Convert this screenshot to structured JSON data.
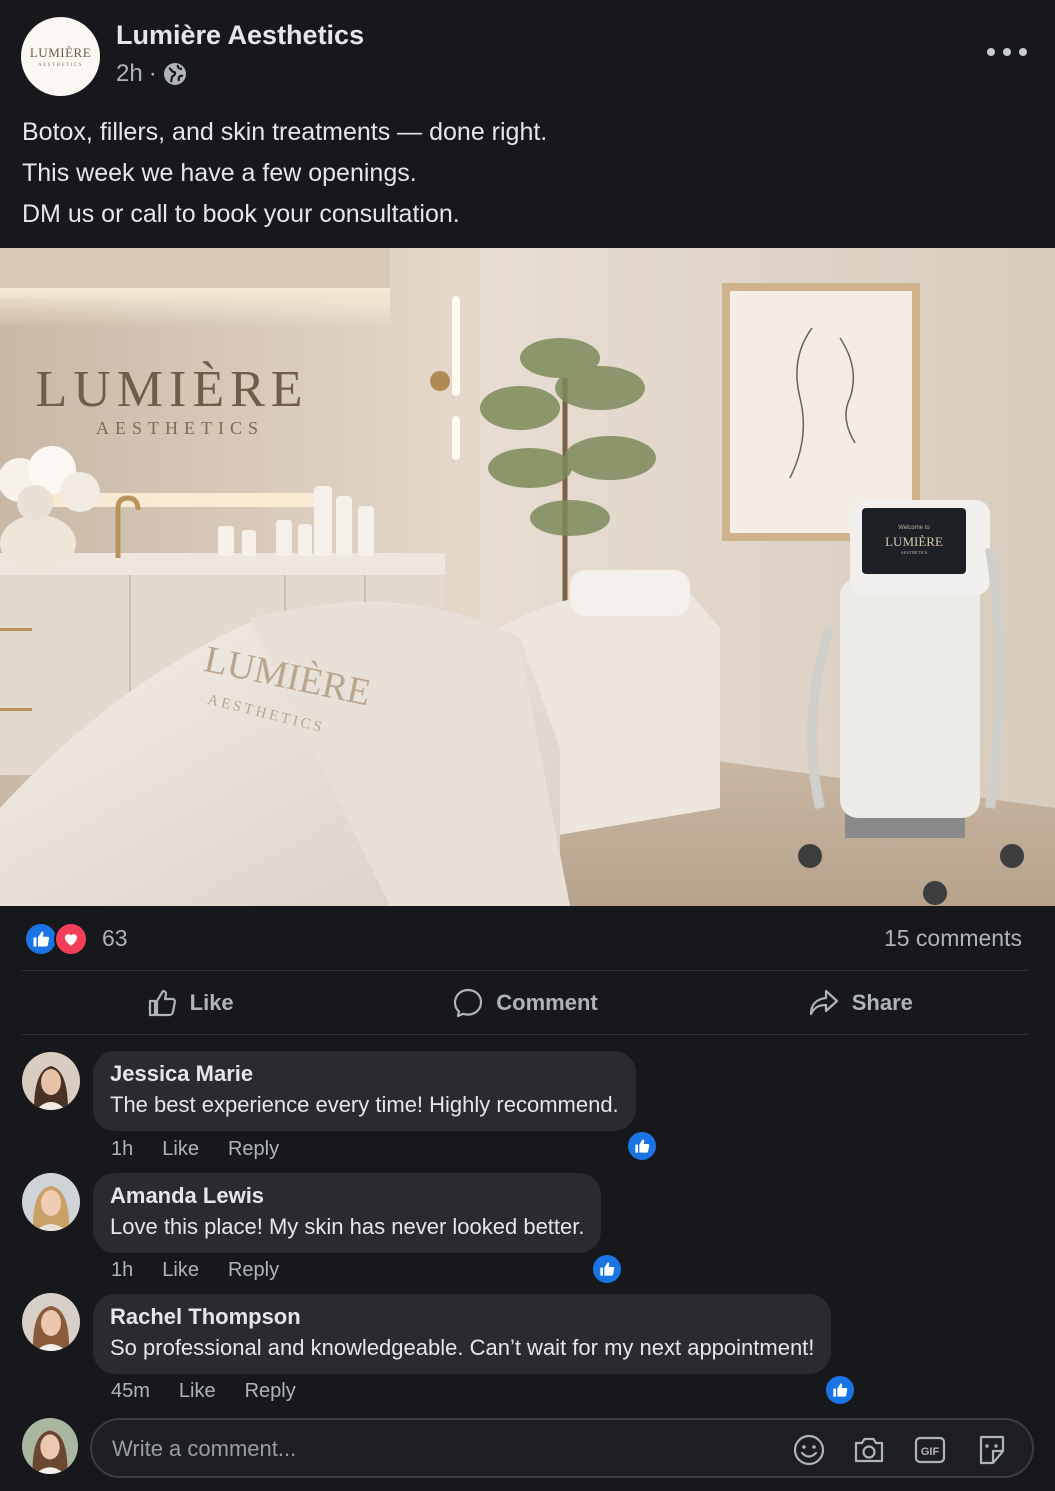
{
  "post": {
    "page_name": "Lumière Aesthetics",
    "logo_text": "LUMIÈRE",
    "logo_subtext": "AESTHETICS",
    "time": "2h",
    "separator": "·",
    "privacy_icon": "globe-icon",
    "text_lines": [
      "Botox, fillers, and skin treatments — done right.",
      "This week we have a few openings.",
      "DM us or call to book your consultation."
    ]
  },
  "image": {
    "wall_sign_main": "LUMIÈRE",
    "wall_sign_sub": "AESTHETICS",
    "towel_main": "LUMIÈRE",
    "towel_sub": "AESTHETICS",
    "screen_welcome": "Welcome to",
    "screen_brand": "LUMIÈRE",
    "screen_sub": "AESTHETICS"
  },
  "reactions": {
    "count": "63",
    "comments": "15 comments",
    "types": [
      "like",
      "love"
    ]
  },
  "actions": {
    "like": "Like",
    "comment": "Comment",
    "share": "Share"
  },
  "comments": [
    {
      "name": "Jessica Marie",
      "text": "The best experience every time! Highly recommend.",
      "time": "1h",
      "like": "Like",
      "reply": "Reply"
    },
    {
      "name": "Amanda Lewis",
      "text": "Love this place! My skin has never looked better.",
      "time": "1h",
      "like": "Like",
      "reply": "Reply"
    },
    {
      "name": "Rachel Thompson",
      "text": "So professional and knowledgeable. Can’t wait for my next appointment!",
      "time": "45m",
      "like": "Like",
      "reply": "Reply"
    }
  ],
  "composer": {
    "placeholder": "Write a comment...",
    "icons": [
      "emoji-icon",
      "camera-icon",
      "gif-icon",
      "sticker-icon"
    ]
  },
  "colors": {
    "background": "#16181c",
    "bubble": "#292b2f",
    "accent_blue": "#1b74e4",
    "love_red": "#f33e58"
  }
}
